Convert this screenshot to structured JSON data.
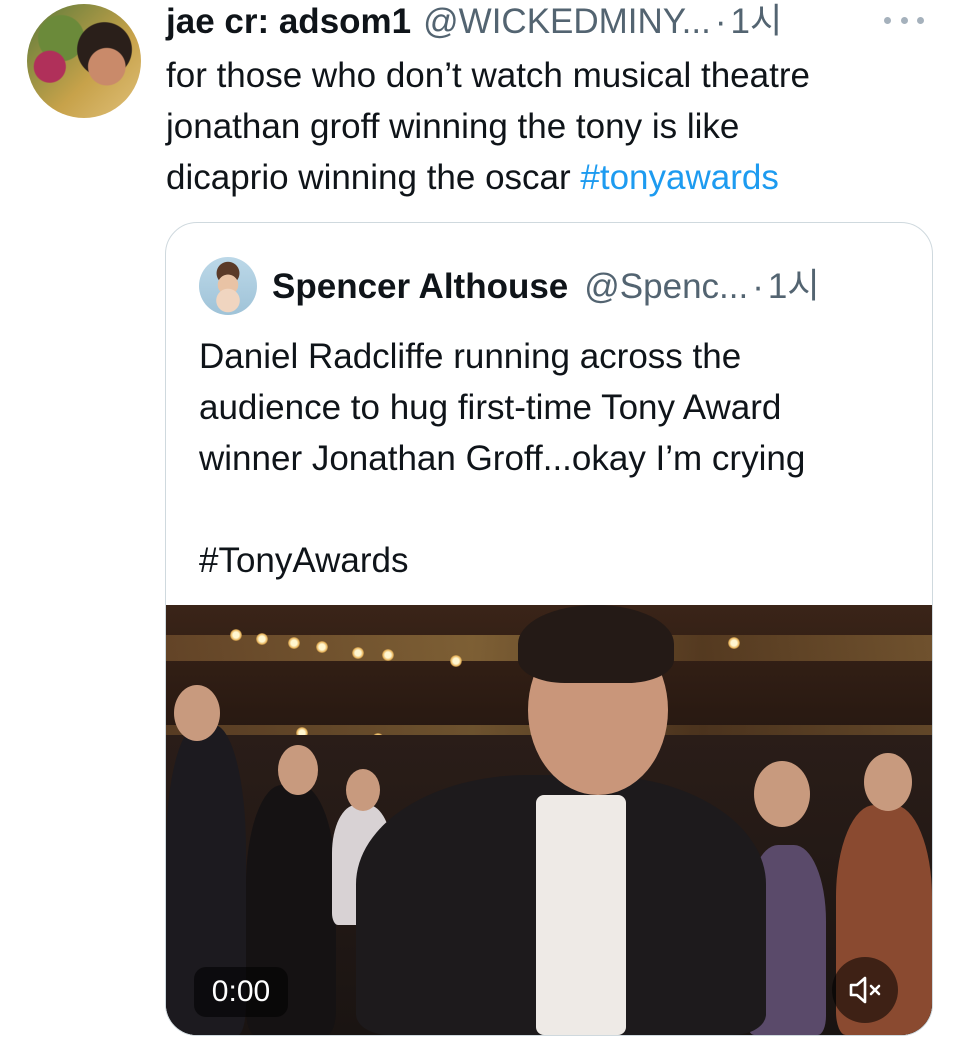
{
  "tweet": {
    "display_name": "jae cr: adsom1",
    "handle": "@WICKEDMINY...",
    "separator": "·",
    "time": "1시",
    "more_icon": "more-horizontal-icon",
    "text_lines": [
      "for those who don’t watch musical theatre",
      "jonathan groff winning the tony is like",
      "dicaprio winning the oscar "
    ],
    "hashtag": "#tonyawards",
    "hashtag_color": "#1d9bf0"
  },
  "quote": {
    "display_name": "Spencer Althouse",
    "handle": "@Spenc...",
    "separator": "·",
    "time": "1시",
    "text_lines": [
      "Daniel Radcliffe running across the",
      "audience to hug first-time Tony Award",
      "winner Jonathan Groff...okay I’m crying"
    ],
    "hashtag_line": "#TonyAwards",
    "video": {
      "time": "0:00",
      "mute_icon": "volume-muted-icon"
    }
  }
}
